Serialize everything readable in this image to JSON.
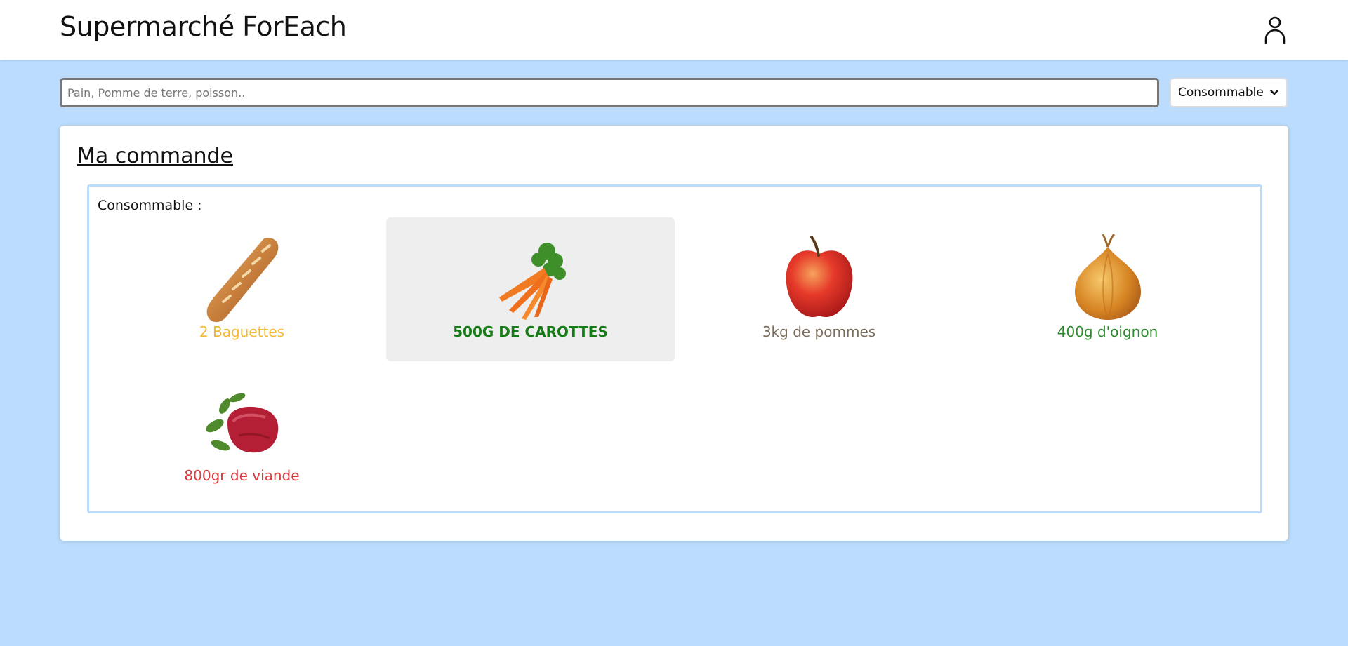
{
  "header": {
    "title": "Supermarché ForEach",
    "user_icon": "user-icon"
  },
  "search": {
    "placeholder": "Pain, Pomme de terre, poisson..",
    "value": ""
  },
  "filter": {
    "selected": "Consommable"
  },
  "order": {
    "title": "Ma commande",
    "category_label": "Consommable :",
    "items": [
      {
        "label": "2 Baguettes",
        "icon": "baguette-image",
        "color": "#f3b939",
        "selected": false
      },
      {
        "label": "500G DE CAROTTES",
        "icon": "carrots-image",
        "color": "#167b16",
        "selected": true
      },
      {
        "label": "3kg de pommes",
        "icon": "apple-image",
        "color": "#7c6e5c",
        "selected": false
      },
      {
        "label": "400g d'oignon",
        "icon": "onion-image",
        "color": "#2c8a2c",
        "selected": false
      },
      {
        "label": "800gr de viande",
        "icon": "meat-image",
        "color": "#d6383d",
        "selected": false
      }
    ]
  },
  "colors": {
    "page_background": "#bbdcfc",
    "order_box_border": "#bbdcfc",
    "selected_item_background": "#eeeeee"
  }
}
